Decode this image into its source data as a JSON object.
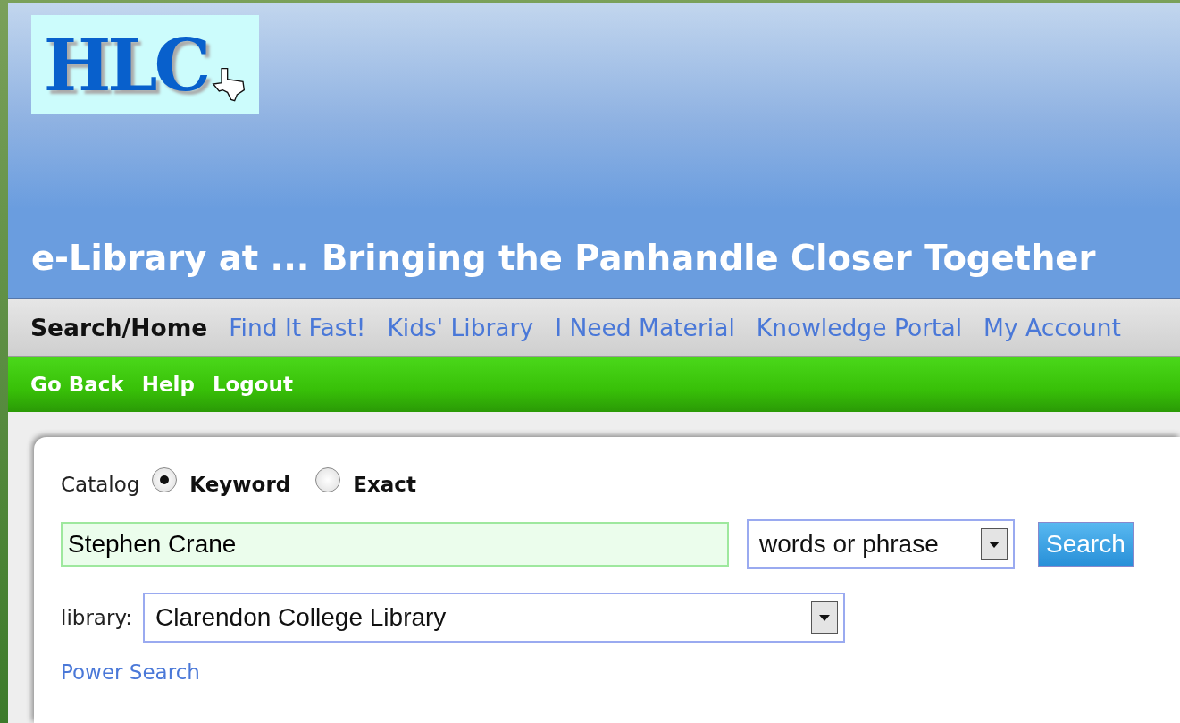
{
  "logo": {
    "text": "HLC"
  },
  "tagline": "e-Library at ... Bringing the Panhandle Closer Together",
  "nav": [
    {
      "label": "Search/Home",
      "selected": true
    },
    {
      "label": "Find It Fast!",
      "selected": false
    },
    {
      "label": "Kids' Library",
      "selected": false
    },
    {
      "label": "I Need Material",
      "selected": false
    },
    {
      "label": "Knowledge Portal",
      "selected": false
    },
    {
      "label": "My Account",
      "selected": false
    }
  ],
  "subnav": [
    "Go Back",
    "Help",
    "Logout"
  ],
  "search": {
    "catalog_label": "Catalog",
    "modes": [
      {
        "label": "Keyword",
        "selected": true
      },
      {
        "label": "Exact",
        "selected": false
      }
    ],
    "query": "Stephen Crane",
    "match": "words or phrase",
    "button": "Search",
    "library_label": "library:",
    "library": "Clarendon College Library",
    "power_search": "Power Search"
  }
}
